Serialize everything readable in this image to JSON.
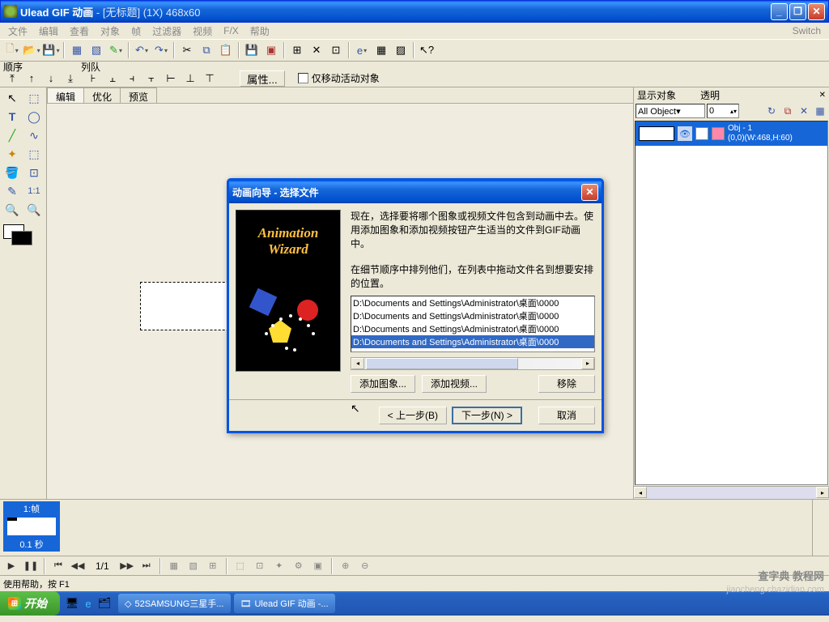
{
  "titlebar": {
    "app_name": "Ulead GIF 动画",
    "doc_title": "- [无标题] (1X) 468x60"
  },
  "menu": {
    "file": "文件",
    "edit": "编辑",
    "view": "查看",
    "object": "对象",
    "frame": "帧",
    "filter": "过滤器",
    "video": "视频",
    "fx": "F/X",
    "help": "帮助",
    "switch": "Switch"
  },
  "toolbar2": {
    "order_label": "顺序",
    "queue_label": "列队",
    "properties": "属性...",
    "move_only": "仅移动活动对象"
  },
  "tabs": {
    "edit": "编辑",
    "optimize": "优化",
    "preview": "预览"
  },
  "props_panel": {
    "show_obj": "显示对象",
    "transparent": "透明",
    "all_objects": "All Object▾",
    "spin_value": "0",
    "obj_name": "Obj - 1",
    "obj_coords": "(0,0)(W:468,H:60)"
  },
  "timeline": {
    "frame_label": "1:帧",
    "frame_time": "0.1 秒"
  },
  "playback": {
    "counter": "1/1"
  },
  "statusbar": {
    "text": "使用帮助，按 F1"
  },
  "taskbar": {
    "start": "开始",
    "task1": "52SAMSUNG三星手...",
    "task2": "Ulead GIF 动画 -..."
  },
  "watermark": {
    "line1": "查字典 教程网",
    "line2": "jiaocheng.chazidian.com"
  },
  "dialog": {
    "title": "动画向导 - 选择文件",
    "wizard1": "Animation",
    "wizard2": "Wizard",
    "para1": "现在，选择要将哪个图象或视频文件包含到动画中去。使用添加图象和添加视频按钮产生适当的文件到GIF动画中。",
    "para2": "在细节顺序中排列他们，在列表中拖动文件名到想要安排的位置。",
    "files": [
      "D:\\Documents and Settings\\Administrator\\桌面\\0000",
      "D:\\Documents and Settings\\Administrator\\桌面\\0000",
      "D:\\Documents and Settings\\Administrator\\桌面\\0000",
      "D:\\Documents and Settings\\Administrator\\桌面\\0000"
    ],
    "add_image": "添加图象...",
    "add_video": "添加视频...",
    "remove": "移除",
    "back": "< 上一步(B)",
    "next": "下一步(N) >",
    "cancel": "取消"
  }
}
